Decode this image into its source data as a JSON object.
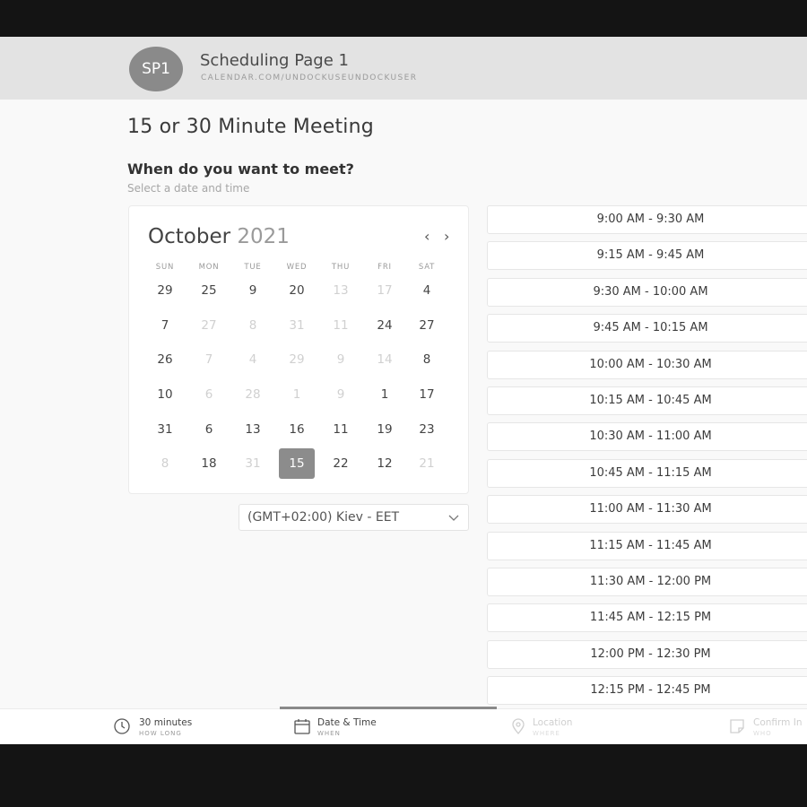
{
  "header": {
    "avatar_initials": "SP1",
    "title": "Scheduling Page 1",
    "subtitle": "CALENDAR.COM/UNDOCKUSEUNDOCKUSER"
  },
  "meeting": {
    "title": "15 or 30 Minute Meeting",
    "question": "When do you want to meet?",
    "hint": "Select a date and time"
  },
  "calendar": {
    "month": "October",
    "year": "2021",
    "prev_icon": "‹",
    "next_icon": "›",
    "weekdays": [
      "SUN",
      "MON",
      "TUE",
      "WED",
      "THU",
      "FRI",
      "SAT"
    ],
    "weeks": [
      [
        {
          "d": "29"
        },
        {
          "d": "25"
        },
        {
          "d": "9"
        },
        {
          "d": "20"
        },
        {
          "d": "13",
          "muted": true
        },
        {
          "d": "17",
          "muted": true
        },
        {
          "d": "4"
        }
      ],
      [
        {
          "d": "7"
        },
        {
          "d": "27",
          "muted": true
        },
        {
          "d": "8",
          "muted": true
        },
        {
          "d": "31",
          "muted": true
        },
        {
          "d": "11",
          "muted": true
        },
        {
          "d": "24"
        },
        {
          "d": "27"
        }
      ],
      [
        {
          "d": "26"
        },
        {
          "d": "7",
          "muted": true
        },
        {
          "d": "4",
          "muted": true
        },
        {
          "d": "29",
          "muted": true
        },
        {
          "d": "9",
          "muted": true
        },
        {
          "d": "14",
          "muted": true
        },
        {
          "d": "8"
        }
      ],
      [
        {
          "d": "10"
        },
        {
          "d": "6",
          "muted": true
        },
        {
          "d": "28",
          "muted": true
        },
        {
          "d": "1",
          "muted": true
        },
        {
          "d": "9",
          "muted": true
        },
        {
          "d": "1"
        },
        {
          "d": "17"
        }
      ],
      [
        {
          "d": "31"
        },
        {
          "d": "6"
        },
        {
          "d": "13"
        },
        {
          "d": "16"
        },
        {
          "d": "11"
        },
        {
          "d": "19"
        },
        {
          "d": "23"
        }
      ],
      [
        {
          "d": "8",
          "muted": true
        },
        {
          "d": "18"
        },
        {
          "d": "31",
          "muted": true
        },
        {
          "d": "15",
          "selected": true
        },
        {
          "d": "22"
        },
        {
          "d": "12"
        },
        {
          "d": "21",
          "muted": true
        }
      ]
    ]
  },
  "timezone": {
    "label": "(GMT+02:00) Kiev - EET"
  },
  "time_slots": [
    "9:00 AM - 9:30 AM",
    "9:15 AM - 9:45 AM",
    "9:30 AM - 10:00 AM",
    "9:45 AM - 10:15 AM",
    "10:00 AM - 10:30 AM",
    "10:15 AM - 10:45 AM",
    "10:30 AM - 11:00 AM",
    "10:45 AM - 11:15 AM",
    "11:00 AM - 11:30 AM",
    "11:15 AM - 11:45 AM",
    "11:30 AM - 12:00 PM",
    "11:45 AM - 12:15 PM",
    "12:00 PM - 12:30 PM",
    "12:15 PM - 12:45 PM"
  ],
  "steps": {
    "duration": {
      "label": "30 minutes",
      "sub": "HOW LONG",
      "icon": "clock-icon"
    },
    "datetime": {
      "label": "Date & Time",
      "sub": "WHEN",
      "icon": "calendar-icon"
    },
    "location": {
      "label": "Location",
      "sub": "WHERE",
      "icon": "location-pin-icon"
    },
    "confirm": {
      "label": "Confirm In",
      "sub": "WHO",
      "icon": "note-icon"
    }
  },
  "colors": {
    "selected_day": "#8c8c8c",
    "avatar": "#8a8a8a",
    "header_bg": "#e3e3e3",
    "page_bg": "#f9f9f9"
  }
}
